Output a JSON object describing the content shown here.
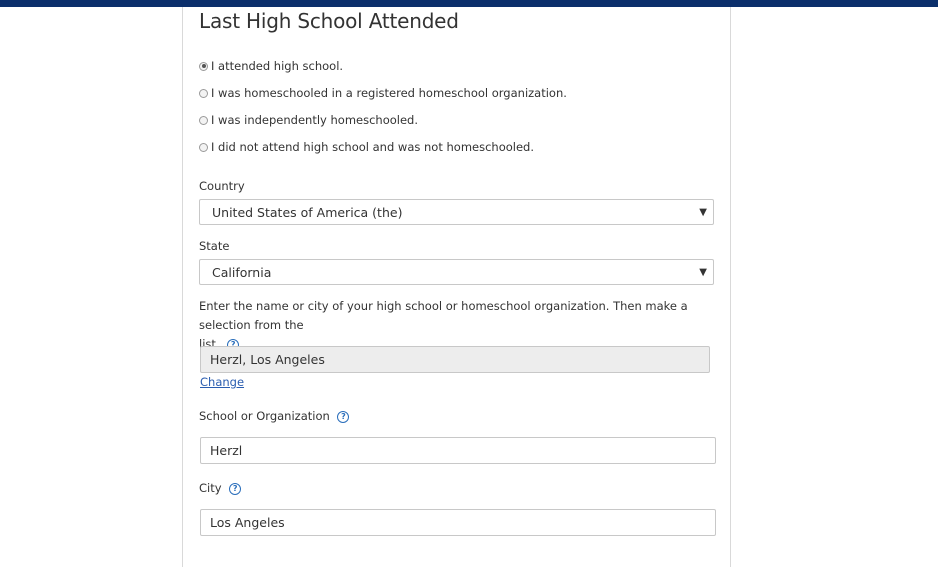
{
  "header": {
    "bar_color": "#0b2f6b"
  },
  "section": {
    "title": "Last High School Attended"
  },
  "attendance_options": [
    {
      "label": "I attended high school.",
      "checked": true
    },
    {
      "label": "I was homeschooled in a registered homeschool organization.",
      "checked": false
    },
    {
      "label": "I was independently homeschooled.",
      "checked": false
    },
    {
      "label": "I did not attend high school and was not homeschooled.",
      "checked": false
    }
  ],
  "country": {
    "label": "Country",
    "value": "United States of America (the)"
  },
  "state": {
    "label": "State",
    "value": "California"
  },
  "school_search": {
    "instructions_line1": "Enter the name or city of your high school or homeschool organization. Then make a selection from the",
    "instructions_line2": "list.",
    "selected_value": "Herzl, Los Angeles",
    "change_label": "Change"
  },
  "school_name": {
    "label": "School or Organization",
    "value": "Herzl"
  },
  "city": {
    "label": "City",
    "value": "Los Angeles"
  },
  "icons": {
    "help": "help-circle-icon",
    "dropdown": "caret-down-icon"
  }
}
